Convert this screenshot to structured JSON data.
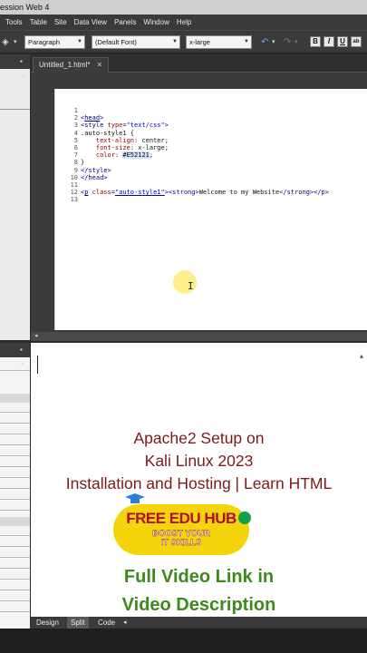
{
  "window": {
    "title": "ession Web 4"
  },
  "menu": [
    "Tools",
    "Table",
    "Site",
    "Data View",
    "Panels",
    "Window",
    "Help"
  ],
  "toolbar": {
    "style_value": "Paragraph",
    "font_value": "(Default Font)",
    "size_value": "x-large",
    "format_buttons": [
      "B",
      "I",
      "U",
      "ab"
    ]
  },
  "editor": {
    "tab_label": "Untitled_1.html*",
    "line_numbers": [
      "1",
      "2",
      "3",
      "4",
      "5",
      "6",
      "7",
      "8",
      "9",
      "10",
      "11",
      "12",
      "13"
    ]
  },
  "view_tabs": [
    "Design",
    "Split",
    "Code"
  ],
  "overlay": {
    "headline_lines": [
      "Apache2 Setup on",
      "Kali Linux 2023",
      "Installation and Hosting | Learn HTML"
    ],
    "logo_title": "FREE EDU HUB",
    "logo_tagline_lines": [
      "BOOST YOUR",
      "IT SKILLS"
    ],
    "cta_lines": [
      "Full Video Link in",
      "Video Description"
    ]
  },
  "colors": {
    "code_color_value": "#E52121",
    "headline": "#7a1a1a",
    "cta": "#3d8a1c",
    "logo_bg": "#f4d40a"
  }
}
